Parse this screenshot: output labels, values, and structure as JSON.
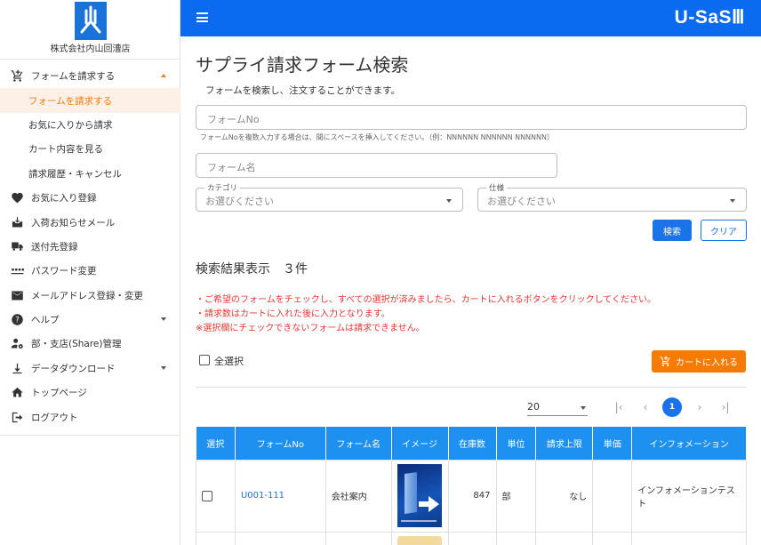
{
  "company": "株式会社内山回漕店",
  "brand": "U-SaSⅢ",
  "colors": {
    "header": "#0b6bf0",
    "accent": "#f07c14",
    "primary": "#1a73e8",
    "note": "#e53935"
  },
  "sidebar": {
    "items": [
      {
        "label": "フォームを請求する",
        "icon": "cart-icon"
      },
      {
        "label": "フォームを請求する"
      },
      {
        "label": "お気に入りから請求"
      },
      {
        "label": "カート内容を見る"
      },
      {
        "label": "請求履歴・キャンセル"
      },
      {
        "label": "お気に入り登録",
        "icon": "heart-icon"
      },
      {
        "label": "入荷お知らせメール",
        "icon": "inbox-icon"
      },
      {
        "label": "送付先登録",
        "icon": "truck-icon"
      },
      {
        "label": "パスワード変更",
        "icon": "password-icon"
      },
      {
        "label": "メールアドレス登録・変更",
        "icon": "mail-icon"
      },
      {
        "label": "ヘルプ",
        "icon": "help-icon"
      },
      {
        "label": "部・支店(Share)管理",
        "icon": "person-gear-icon"
      },
      {
        "label": "データダウンロード",
        "icon": "download-icon"
      },
      {
        "label": "トップページ",
        "icon": "home-icon"
      },
      {
        "label": "ログアウト",
        "icon": "logout-icon"
      }
    ]
  },
  "page": {
    "title": "サプライ請求フォーム検索",
    "description": "フォームを検索し、注文することができます。"
  },
  "search": {
    "form_no_placeholder": "フォームNo",
    "form_no_hint": "フォームNoを複数入力する場合は、間にスペースを挿入してください。（例：NNNNNN NNNNNN NNNNNN）",
    "form_name_placeholder": "フォーム名",
    "category_label": "カテゴリ",
    "category_value": "お選びください",
    "spec_label": "仕様",
    "spec_value": "お選びください",
    "search_button": "検索",
    "clear_button": "クリア"
  },
  "results": {
    "title": "検索結果表示　３件",
    "notes": [
      "・ご希望のフォームをチェックし、すべての選択が済みましたら、カートに入れるボタンをクリックしてください。",
      "・請求数はカートに入れた後に入力となります。",
      "※選択欄にチェックできないフォームは請求できません。"
    ],
    "select_all": "全選択",
    "add_to_cart": "カートに入れる",
    "per_page": "20",
    "pagination": {
      "first": "|‹",
      "prev": "‹",
      "current": "1",
      "next": "›",
      "last": "›|"
    },
    "columns": [
      "選択",
      "フォームNo",
      "フォーム名",
      "イメージ",
      "在庫数",
      "単位",
      "請求上限",
      "単価",
      "インフォメーション"
    ],
    "rows": [
      {
        "form_no": "U001-111",
        "form_name": "会社案内",
        "stock": "847",
        "unit": "部",
        "limit": "なし",
        "price": "",
        "info": "インフォメーションテスト"
      }
    ]
  }
}
